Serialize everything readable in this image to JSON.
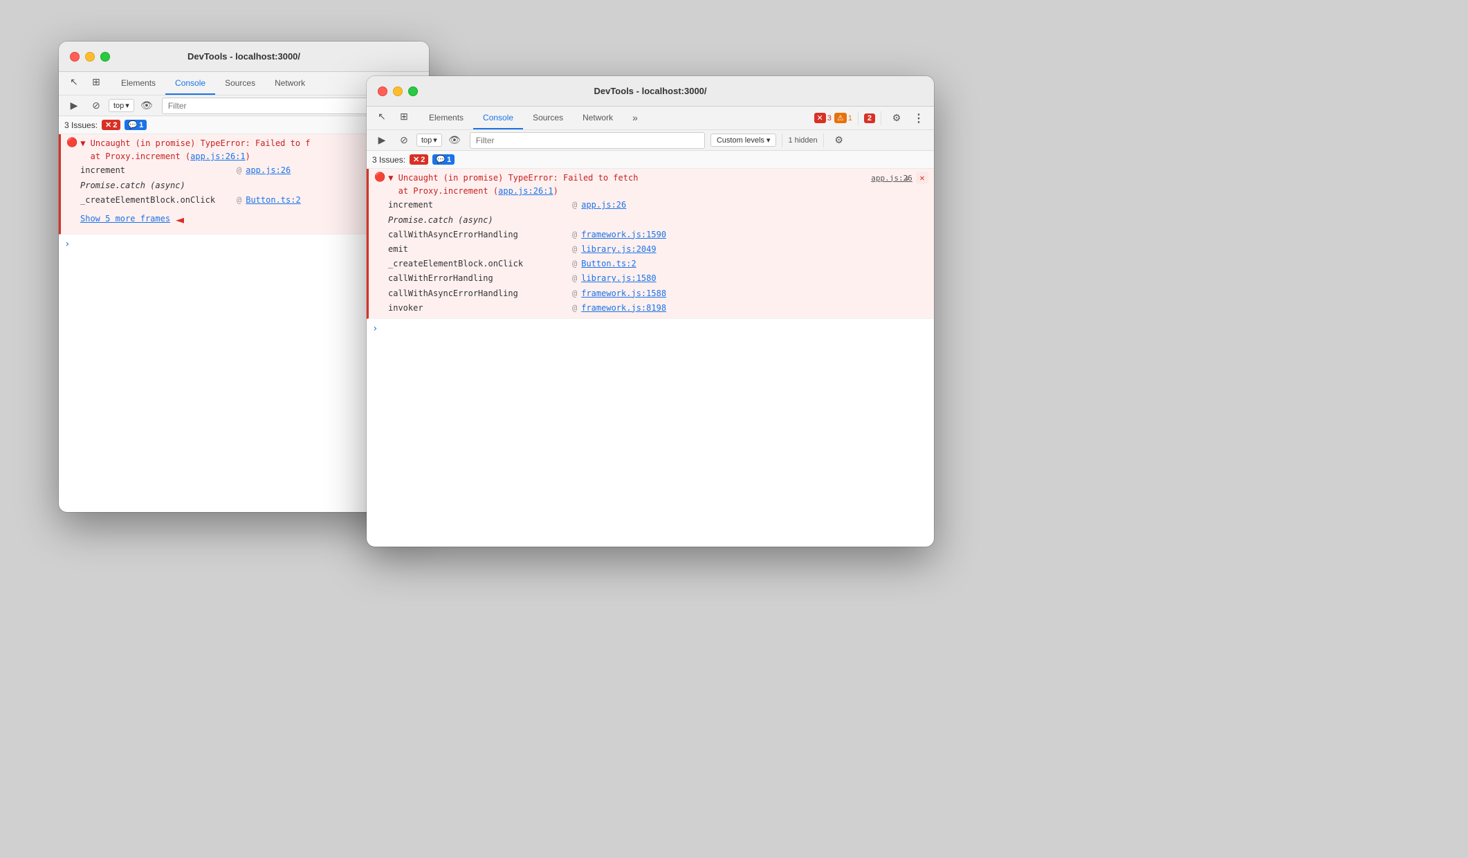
{
  "window1": {
    "title": "DevTools - localhost:3000/",
    "tabs": [
      {
        "label": "Elements",
        "active": false
      },
      {
        "label": "Console",
        "active": true
      },
      {
        "label": "Sources",
        "active": false
      },
      {
        "label": "Network",
        "active": false
      }
    ],
    "toolbar": {
      "top_label": "top",
      "filter_placeholder": "Filter"
    },
    "issues": {
      "label": "3 Issues:",
      "error_count": "2",
      "info_count": "1"
    },
    "console_entries": [
      {
        "type": "error",
        "message": "▼ Uncaught (in promise) TypeError: Failed to f",
        "sub": "at Proxy.increment (app.js:26:1)",
        "link": "app.js:26"
      }
    ],
    "stack_frames": [
      {
        "func": "increment",
        "at": "@",
        "link": "app.js:26",
        "italic": false
      },
      {
        "func": "Promise.catch (async)",
        "at": "",
        "link": "",
        "italic": true
      },
      {
        "func": "_createElementBlock.onClick",
        "at": "@",
        "link": "Button.ts:2",
        "italic": false
      }
    ],
    "show_more": "Show 5 more frames"
  },
  "window2": {
    "title": "DevTools - localhost:3000/",
    "tabs": [
      {
        "label": "Elements",
        "active": false
      },
      {
        "label": "Console",
        "active": true
      },
      {
        "label": "Sources",
        "active": false
      },
      {
        "label": "Network",
        "active": false
      }
    ],
    "toolbar": {
      "top_label": "top",
      "filter_placeholder": "Filter",
      "custom_levels": "Custom levels",
      "hidden_label": "1 hidden"
    },
    "badge_error": "3",
    "badge_warn": "1",
    "badge_info2": "2",
    "issues": {
      "label": "3 Issues:",
      "error_count": "2",
      "info_count": "1"
    },
    "error_entry": {
      "message_main": "▼ Uncaught (in promise) TypeError: Failed to fetch",
      "message_sub": "at Proxy.increment (app.js:26:1)",
      "link_main": "app.js:26"
    },
    "stack_frames": [
      {
        "func": "increment",
        "at": "@",
        "link": "app.js:26",
        "italic": false
      },
      {
        "func": "Promise.catch (async)",
        "at": "",
        "link": "",
        "italic": true
      },
      {
        "func": "callWithAsyncErrorHandling",
        "at": "@",
        "link": "framework.js:1590",
        "italic": false
      },
      {
        "func": "emit",
        "at": "@",
        "link": "library.js:2049",
        "italic": false
      },
      {
        "func": "_createElementBlock.onClick",
        "at": "@",
        "link": "Button.ts:2",
        "italic": false
      },
      {
        "func": "callWithErrorHandling",
        "at": "@",
        "link": "library.js:1580",
        "italic": false
      },
      {
        "func": "callWithAsyncErrorHandling",
        "at": "@",
        "link": "framework.js:1588",
        "italic": false
      },
      {
        "func": "invoker",
        "at": "@",
        "link": "framework.js:8198",
        "italic": false
      }
    ]
  },
  "icons": {
    "cursor": "↖",
    "layers": "⊞",
    "play": "▶",
    "block": "⊘",
    "eye": "👁",
    "chevron_down": "▾",
    "gear": "⚙",
    "more": "⋮",
    "more_tabs": "»",
    "error_x": "✕",
    "warn_triangle": "⚠",
    "download": "↓",
    "close_x": "✕"
  }
}
